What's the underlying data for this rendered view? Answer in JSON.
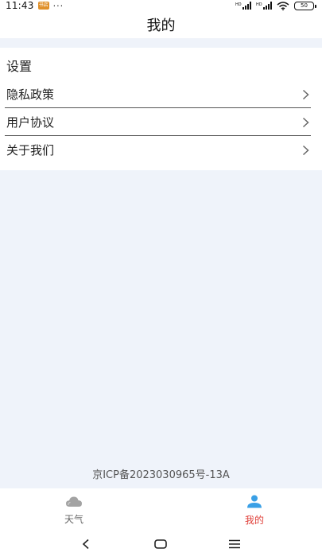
{
  "status_bar": {
    "time": "11:43",
    "badge": "书店",
    "dots": "···",
    "battery": "50"
  },
  "header": {
    "title": "我的"
  },
  "settings": {
    "section_title": "设置",
    "items": [
      {
        "label": "隐私政策"
      },
      {
        "label": "用户协议"
      },
      {
        "label": "关于我们"
      }
    ]
  },
  "footer": {
    "icp": "京ICP备2023030965号-13A"
  },
  "tabs": [
    {
      "label": "天气",
      "icon": "cloud-icon",
      "active": false
    },
    {
      "label": "我的",
      "icon": "user-icon",
      "active": true
    }
  ],
  "colors": {
    "page_bg": "#eff3fa",
    "active_tab": "#e0403a",
    "active_icon": "#3aa0e6",
    "inactive": "#9a9a9a"
  }
}
